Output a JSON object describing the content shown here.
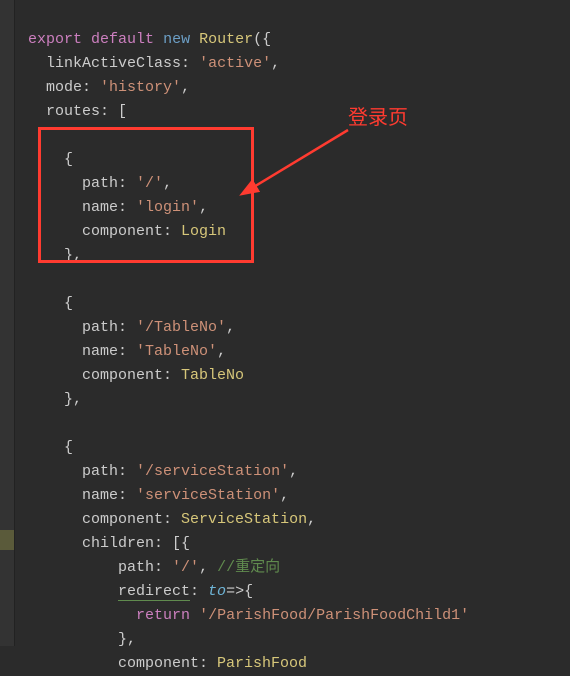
{
  "code": {
    "l1_export": "export",
    "l1_default": "default",
    "l1_new": "new",
    "l1_router": "Router",
    "l1_open": "({",
    "l2_key": "linkActiveClass",
    "l2_val": "'active'",
    "l3_key": "mode",
    "l3_val": "'history'",
    "l4_key": "routes",
    "l4_open": "[",
    "r1_open": "{",
    "r1_path_k": "path",
    "r1_path_v": "'/'",
    "r1_name_k": "name",
    "r1_name_v": "'login'",
    "r1_comp_k": "component",
    "r1_comp_v": "Login",
    "r1_close": "},",
    "r2_open": "{",
    "r2_path_k": "path",
    "r2_path_v": "'/TableNo'",
    "r2_name_k": "name",
    "r2_name_v": "'TableNo'",
    "r2_comp_k": "component",
    "r2_comp_v": "TableNo",
    "r2_close": "},",
    "r3_open": "{",
    "r3_path_k": "path",
    "r3_path_v": "'/serviceStation'",
    "r3_name_k": "name",
    "r3_name_v": "'serviceStation'",
    "r3_comp_k": "component",
    "r3_comp_v": "ServiceStation",
    "r3_child_k": "children",
    "r3_child_open": "[{",
    "c1_path_k": "path",
    "c1_path_v": "'/'",
    "c1_comment": "//重定向",
    "c1_redirect_k": "redirect",
    "c1_redirect_to": "to",
    "c1_arrow": "=>",
    "c1_open": "{",
    "c1_return": "return",
    "c1_return_v": "'/ParishFood/ParishFoodChild1'",
    "c1_close": "},",
    "c2_comp_k": "component",
    "c2_comp_v": "ParishFood"
  },
  "annotation": {
    "label": "登录页"
  }
}
